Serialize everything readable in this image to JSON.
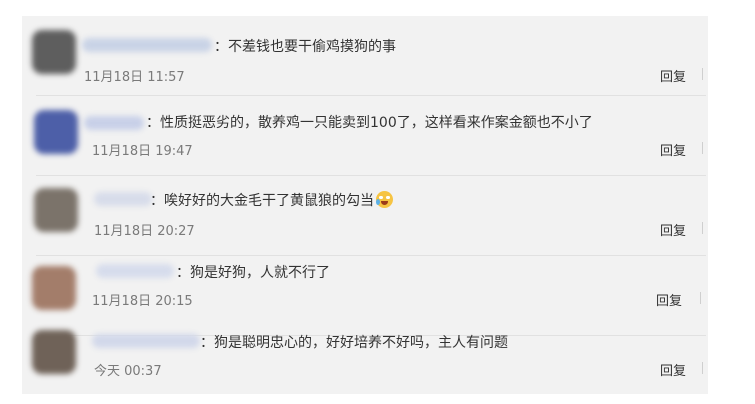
{
  "comments": [
    {
      "text": "不差钱也要干偷鸡摸狗的事",
      "time": "11月18日 11:57",
      "reply_label": "回复",
      "avatar_color": "#5e5e5e",
      "name_color": "#c9d3e6"
    },
    {
      "text": "性质挺恶劣的，散养鸡一只能卖到100了，这样看来作案金额也不小了",
      "time": "11月18日 19:47",
      "reply_label": "回复",
      "avatar_color": "#4d5fa8",
      "name_color": "#c8d0e8"
    },
    {
      "text": "唉好好的大金毛干了黄鼠狼的勾当",
      "time": "11月18日 20:27",
      "reply_label": "回复",
      "avatar_color": "#7b736a",
      "name_color": "#d7dcea",
      "emoji": "laughing-crying-emoji"
    },
    {
      "text": "狗是好狗，人就不行了",
      "time": "11月18日 20:15",
      "reply_label": "回复",
      "avatar_color": "#a37d6a",
      "name_color": "#d6dcec"
    },
    {
      "text": "狗是聪明忠心的，好好培养不好吗，主人有问题",
      "time": "今天 00:37",
      "reply_label": "回复",
      "avatar_color": "#6f6258",
      "name_color": "#d2d8ea"
    }
  ],
  "colon": "："
}
